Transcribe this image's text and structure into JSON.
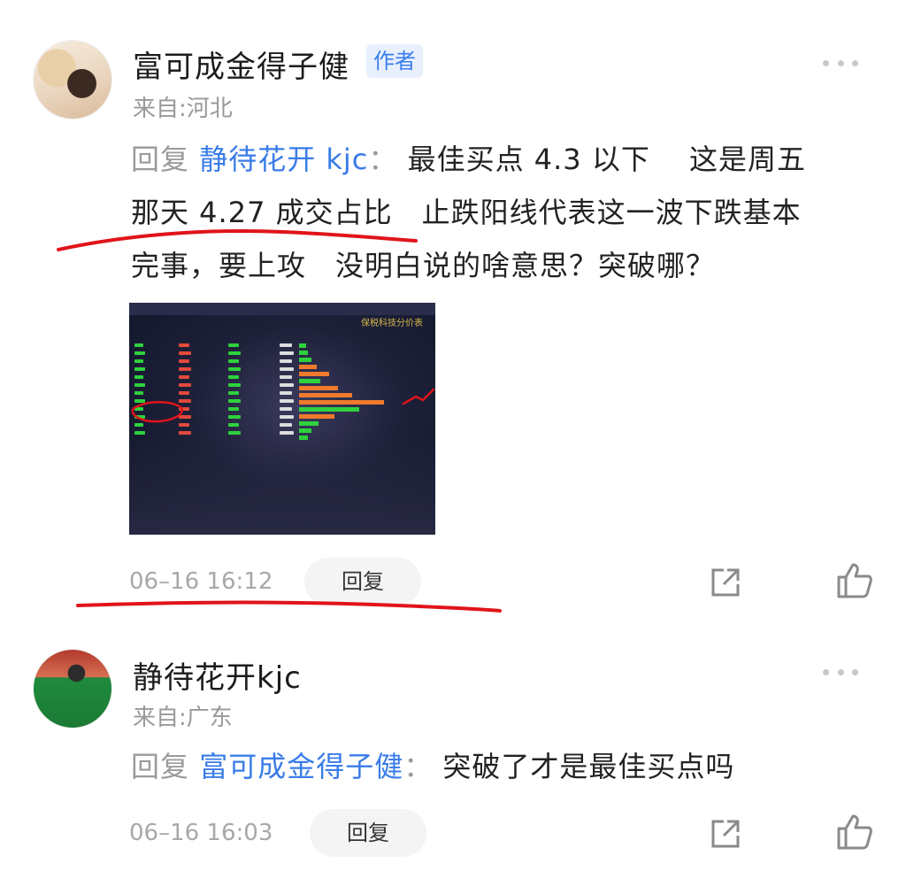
{
  "comments": [
    {
      "user_name": "富可成金得子健",
      "badge": "作者",
      "location": "来自:河北",
      "reply_prefix": "回复",
      "reply_to": "静待花开 kjc",
      "separator": "：",
      "text_line1": "最佳买点 4.3 以下　 这是周五",
      "text_line2": "那天 4.27 成交占比　止跌阳线代表这一波下跌基本",
      "text_line3": "完事，要上攻　没明白说的啥意思？突破哪？",
      "embedded_image": {
        "title": "保税科技分价表",
        "description": "price-distribution screenshot"
      },
      "timestamp": "06–16 16:12",
      "reply_button": "回复"
    },
    {
      "user_name": "静待花开kjc",
      "location": "来自:广东",
      "reply_prefix": "回复",
      "reply_to": "富可成金得子健",
      "separator": "：",
      "text_line1": "突破了才是最佳买点吗",
      "timestamp": "06–16 16:03",
      "reply_button": "回复"
    }
  ],
  "icons": {
    "more": "more-horizontal-icon",
    "share": "share-icon",
    "like": "thumbs-up-icon"
  },
  "colors": {
    "mention": "#3a7ce8",
    "badge_bg": "#e8f0fd",
    "muted": "#9a9a9a",
    "annotation": "#e0141a"
  }
}
